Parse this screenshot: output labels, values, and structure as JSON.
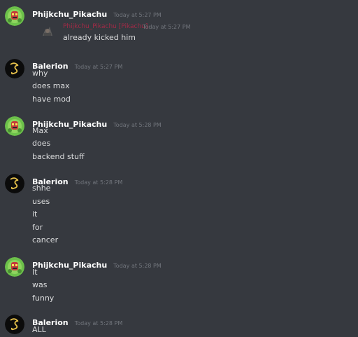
{
  "messages": [
    {
      "username": "Phijkchu_Pikachu",
      "timestamp": "Today at 5:27 PM",
      "avatar": "pikachu-avatar",
      "lines": [],
      "embed": {
        "name": "Phijkchu_Pikachu [Pikachu]",
        "timestamp": "Today at 5:27 PM",
        "text": "already kicked him"
      }
    },
    {
      "username": "Balerion",
      "timestamp": "Today at 5:27 PM",
      "avatar": "dragon-avatar",
      "lines": [
        "why",
        "does max",
        "have mod"
      ]
    },
    {
      "username": "Phijkchu_Pikachu",
      "timestamp": "Today at 5:28 PM",
      "avatar": "pikachu-avatar",
      "lines": [
        "Max",
        "does",
        "backend stuff"
      ]
    },
    {
      "username": "Balerion",
      "timestamp": "Today at 5:28 PM",
      "avatar": "dragon-avatar",
      "lines": [
        "shhe",
        "uses",
        "it",
        "for",
        "cancer"
      ]
    },
    {
      "username": "Phijkchu_Pikachu",
      "timestamp": "Today at 5:28 PM",
      "avatar": "pikachu-avatar",
      "lines": [
        "It",
        "was",
        "funny"
      ]
    },
    {
      "username": "Balerion",
      "timestamp": "Today at 5:28 PM",
      "avatar": "dragon-avatar",
      "lines": [
        "ALL"
      ]
    }
  ],
  "colors": {
    "background": "#36393f",
    "username": "#ffffff",
    "timestamp": "#72767d",
    "text": "#dcddde",
    "embed_name": "#a12a46"
  }
}
